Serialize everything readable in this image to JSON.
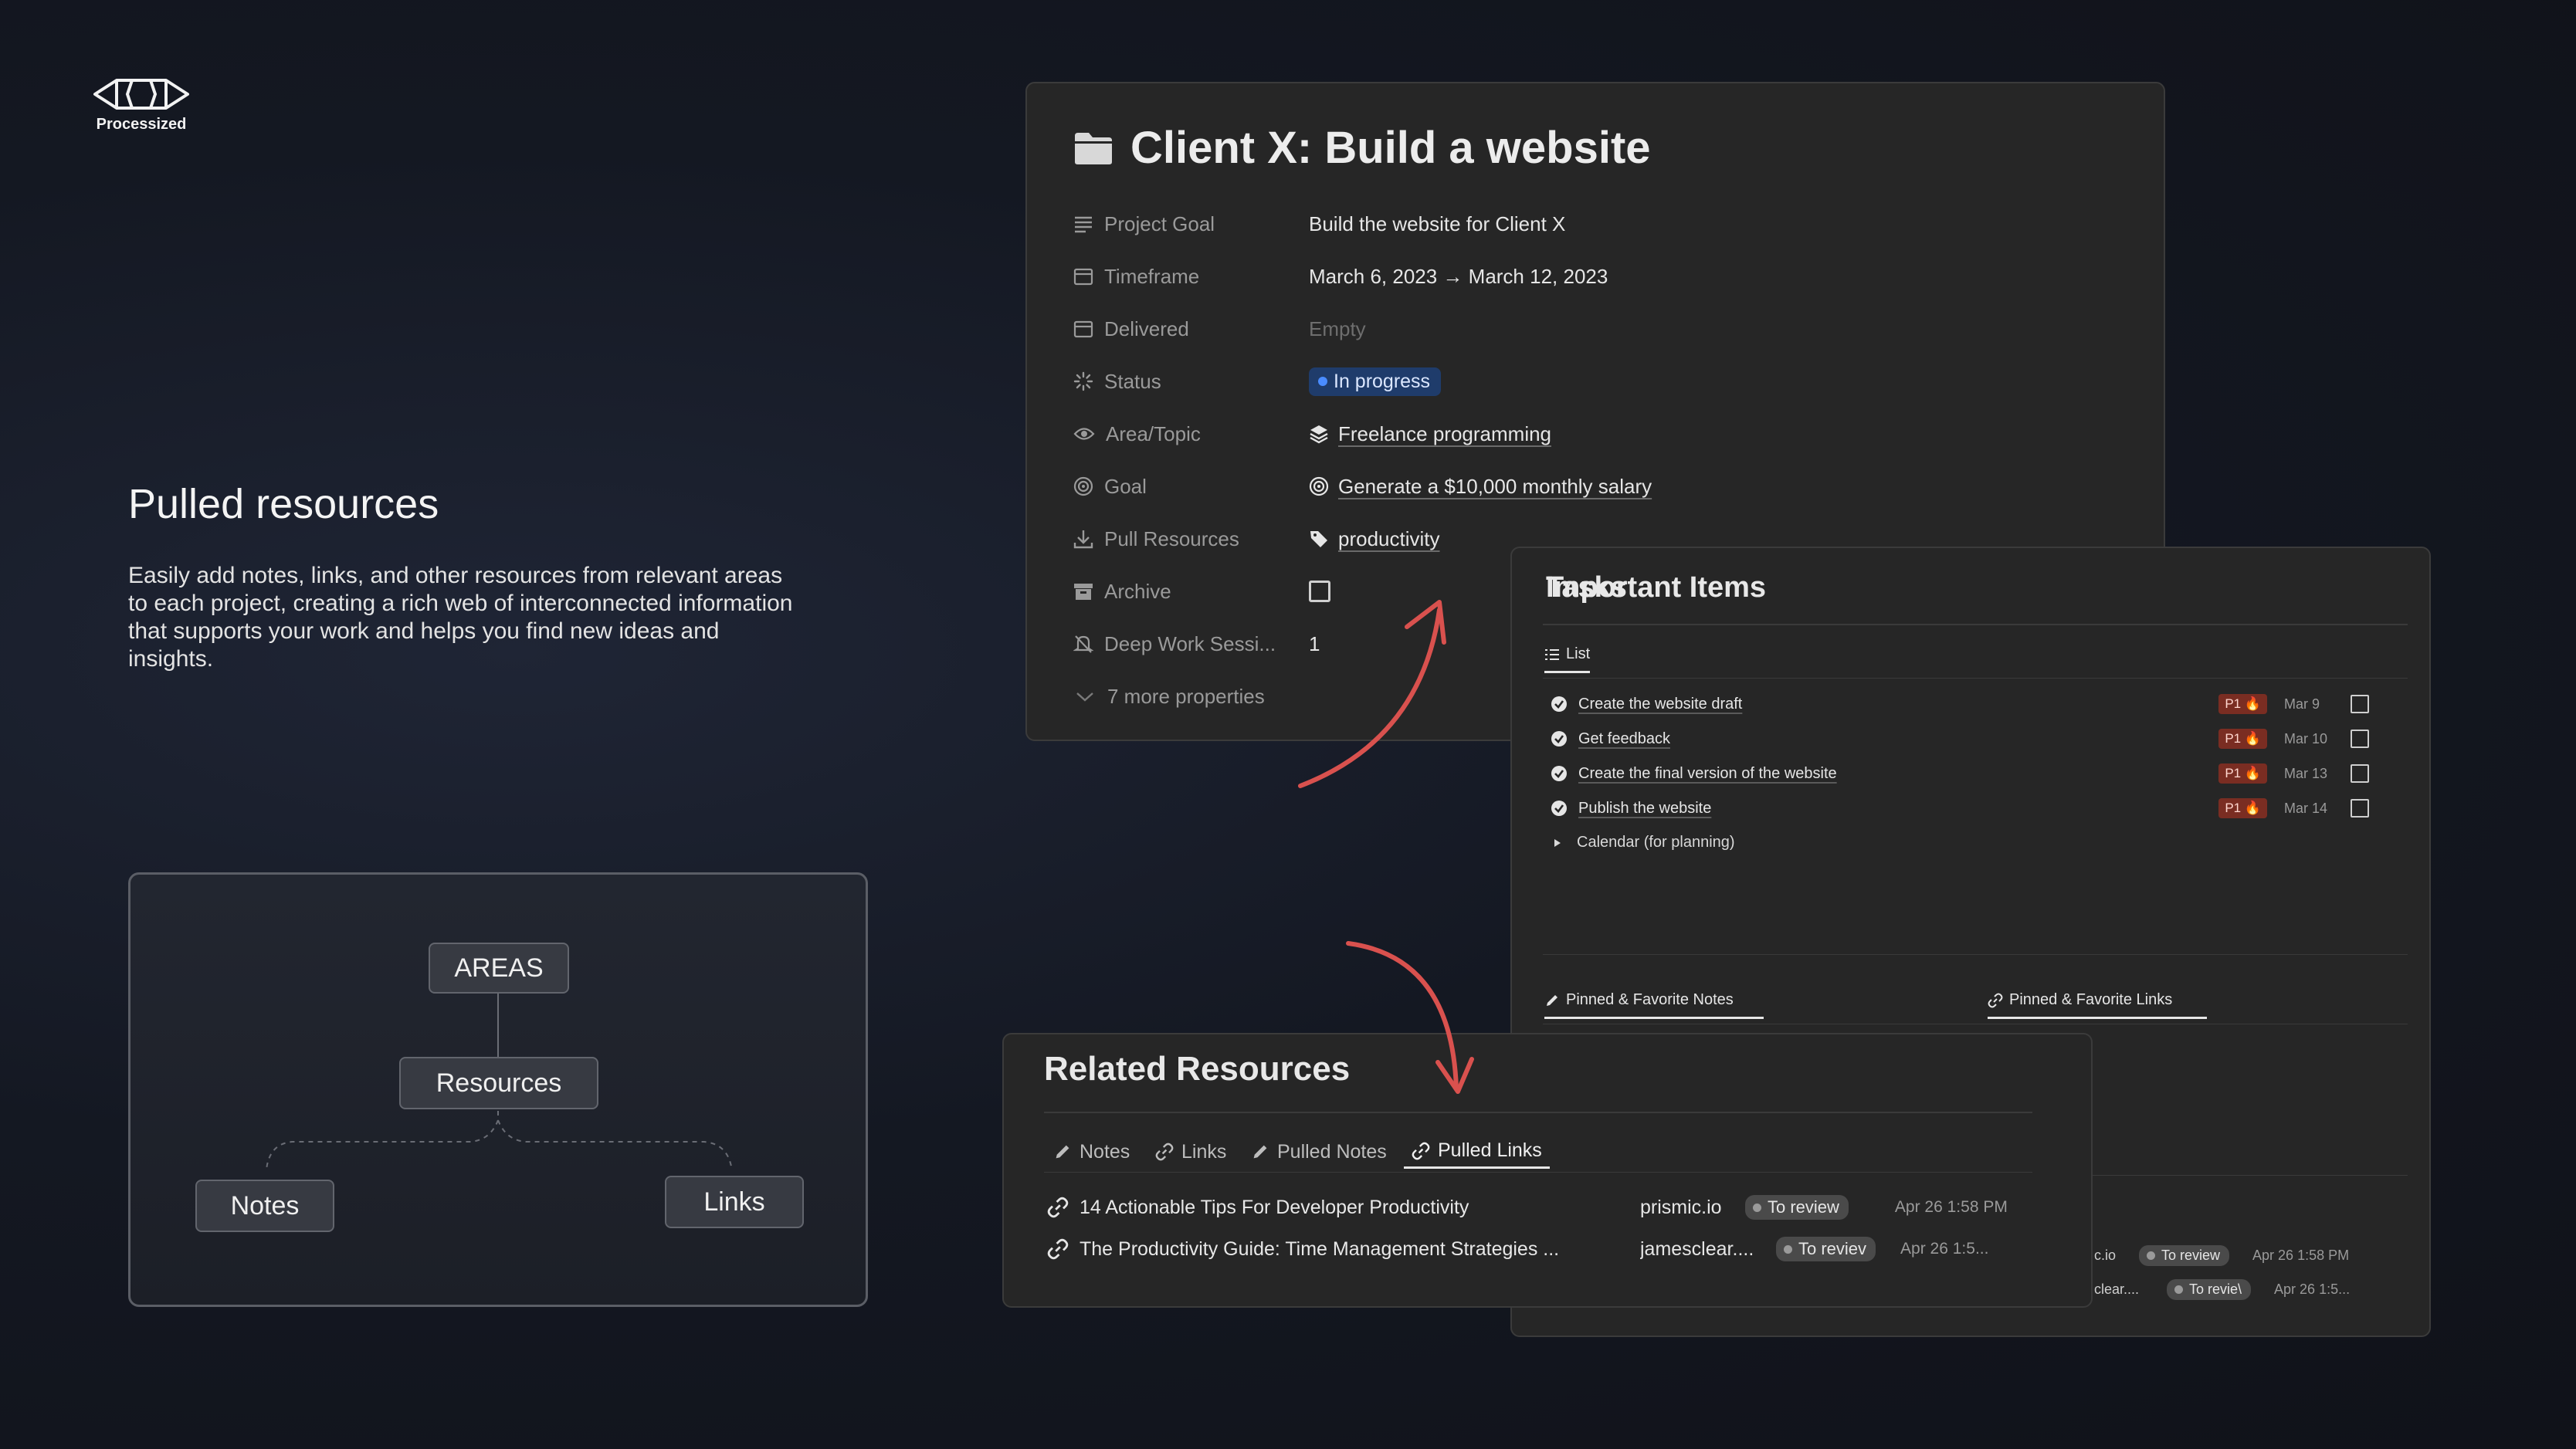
{
  "brand": {
    "name": "Processized",
    "logo_icon": "processized-logo"
  },
  "hero": {
    "title": "Pulled resources",
    "description": "Easily add notes, links, and other resources from relevant areas to each project, creating a rich web of interconnected information that supports your work and helps you find new ideas and insights."
  },
  "diagram": {
    "nodes": {
      "areas": "AREAS",
      "resources": "Resources",
      "notes": "Notes",
      "links": "Links"
    }
  },
  "project": {
    "icon": "folder-icon",
    "title": "Client X: Build a website",
    "properties": {
      "project_goal": {
        "label": "Project Goal",
        "value": "Build the website for Client X"
      },
      "timeframe": {
        "label": "Timeframe",
        "value": "March 6, 2023 → March 12, 2023"
      },
      "delivered": {
        "label": "Delivered",
        "value": "Empty"
      },
      "status": {
        "label": "Status",
        "value": "In progress"
      },
      "area_topic": {
        "label": "Area/Topic",
        "value": "Freelance programming"
      },
      "goal": {
        "label": "Goal",
        "value": "Generate a $10,000 monthly salary"
      },
      "pull_resources": {
        "label": "Pull Resources",
        "value": "productivity"
      },
      "archive": {
        "label": "Archive",
        "checked": false
      },
      "deep_work": {
        "label": "Deep Work Sessi...",
        "value": "1"
      }
    },
    "more_properties": "7 more properties",
    "colors": {
      "status_bg": "#1f3c6b",
      "status_dot": "#4a8cff"
    }
  },
  "tasks": {
    "title": "Tasks",
    "view_tab": "List",
    "items": [
      {
        "name": "Create the website draft",
        "priority": "P1 🔥",
        "date": "Mar 9"
      },
      {
        "name": "Get feedback",
        "priority": "P1 🔥",
        "date": "Mar 10"
      },
      {
        "name": "Create the final version of the website",
        "priority": "P1 🔥",
        "date": "Mar 13"
      },
      {
        "name": "Publish the website",
        "priority": "P1 🔥",
        "date": "Mar 14"
      }
    ],
    "calendar": "Calendar (for planning)",
    "important_title": "Important Items",
    "important_tabs": {
      "notes": "Pinned & Favorite Notes",
      "links": "Pinned & Favorite Links"
    },
    "underlying_rows": [
      {
        "domain": "c.io",
        "status": "To review",
        "date": "Apr 26 1:58 PM"
      },
      {
        "domain": "clear....",
        "status": "To revie\\",
        "date": "Apr 26 1:5..."
      }
    ],
    "colors": {
      "p1_bg": "#7a2d22"
    }
  },
  "related": {
    "title": "Related Resources",
    "tabs": {
      "notes": "Notes",
      "links": "Links",
      "pulled_notes": "Pulled Notes",
      "pulled_links": "Pulled Links"
    },
    "active_tab": "Pulled Links",
    "links": [
      {
        "name": "14 Actionable Tips For Developer Productivity",
        "domain": "prismic.io",
        "status": "To review",
        "date": "Apr 26 1:58 PM"
      },
      {
        "name": "The Productivity Guide: Time Management Strategies ...",
        "domain": "jamesclear....",
        "status": "To reviev",
        "date": "Apr 26 1:5..."
      }
    ]
  },
  "accent": {
    "arrow": "#d9514e"
  }
}
